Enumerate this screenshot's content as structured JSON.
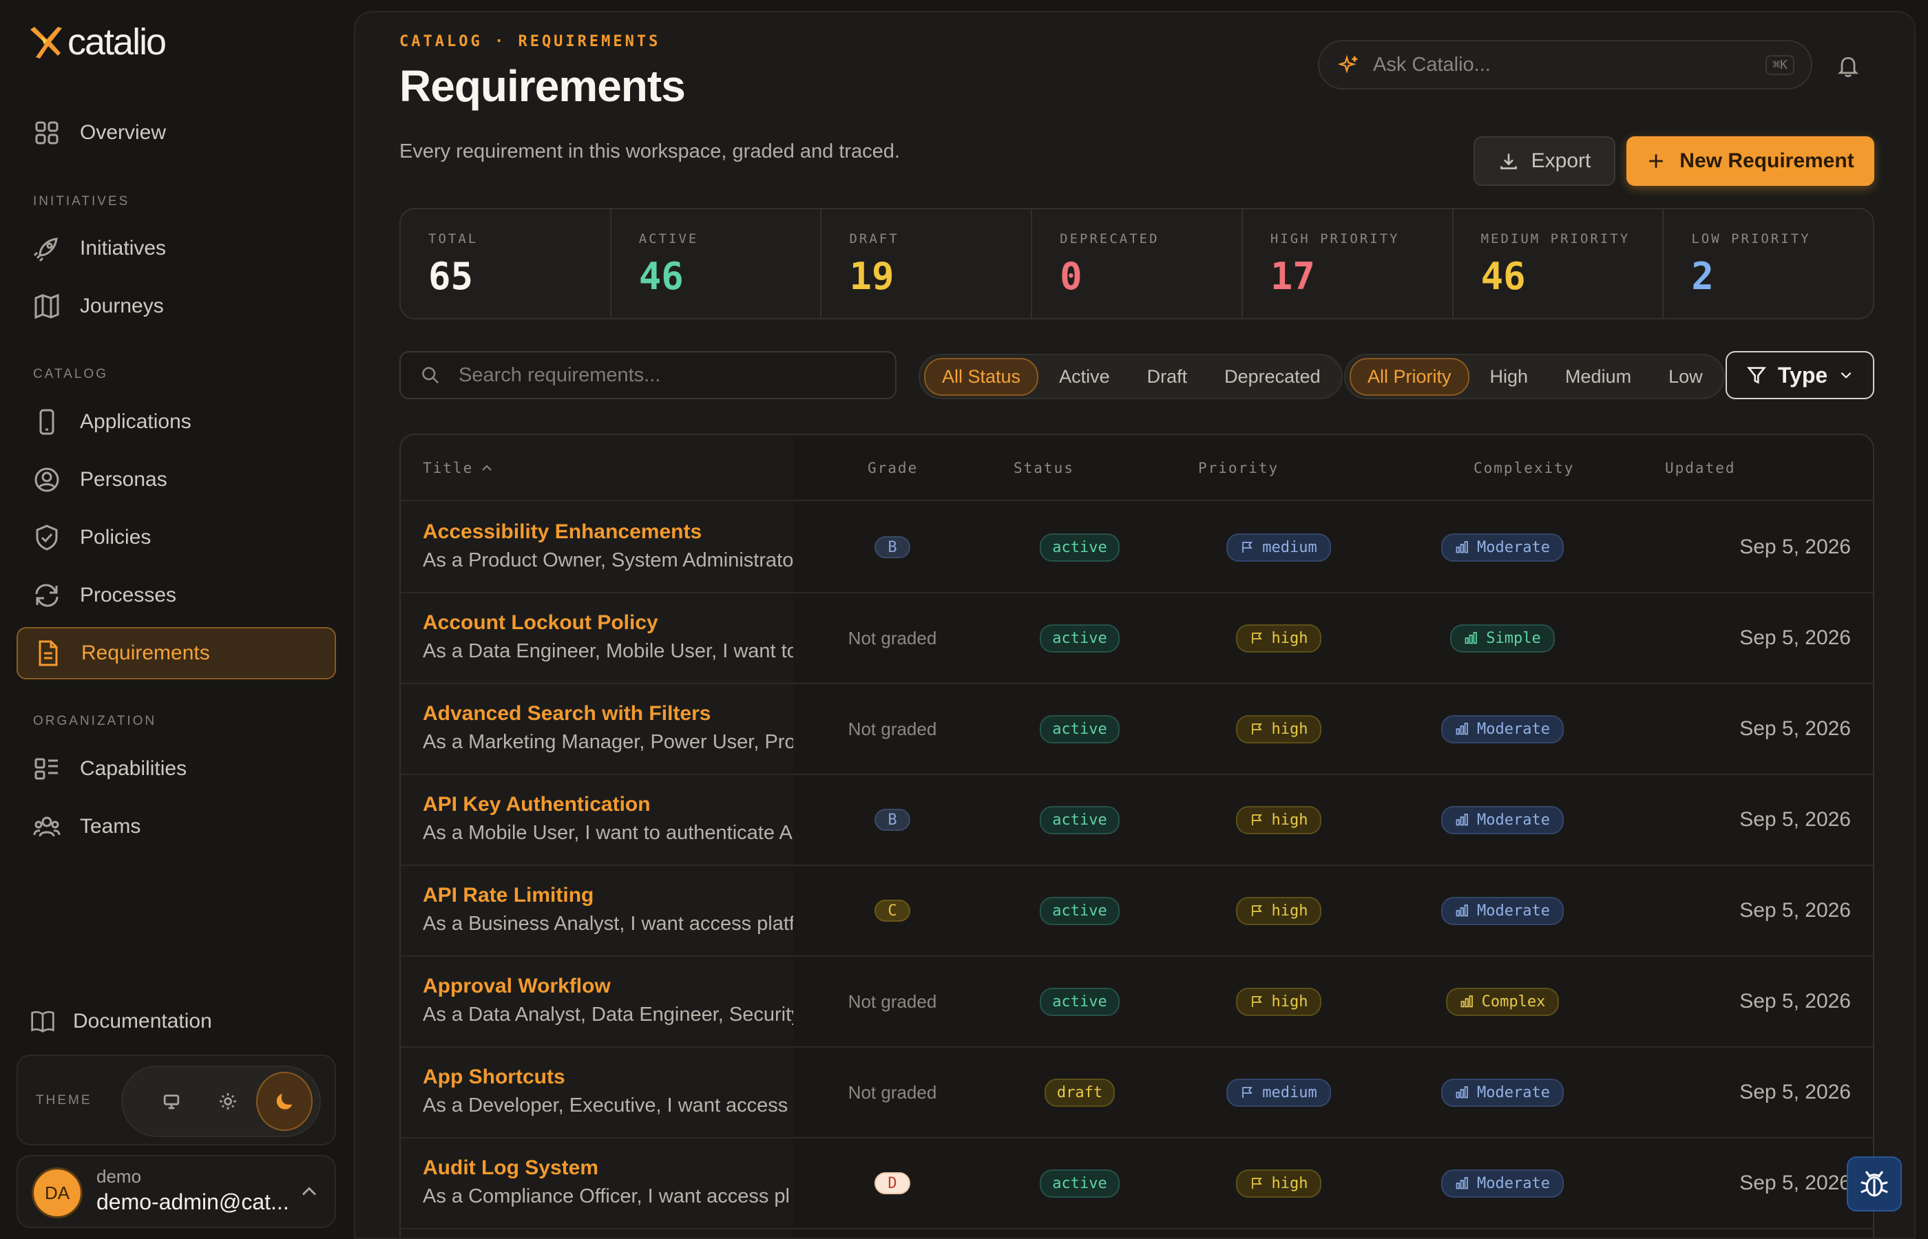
{
  "brand": {
    "name": "catalio"
  },
  "sidebar": {
    "overview": "Overview",
    "section_initiatives": "INITIATIVES",
    "initiatives": "Initiatives",
    "journeys": "Journeys",
    "section_catalog": "CATALOG",
    "applications": "Applications",
    "personas": "Personas",
    "policies": "Policies",
    "processes": "Processes",
    "requirements": "Requirements",
    "section_organization": "ORGANIZATION",
    "capabilities": "Capabilities",
    "teams": "Teams",
    "documentation": "Documentation",
    "theme_label": "THEME",
    "user": {
      "initials": "DA",
      "name": "demo",
      "email": "demo-admin@cat..."
    }
  },
  "header": {
    "breadcrumb": "CATALOG · REQUIREMENTS",
    "title": "Requirements",
    "subtitle": "Every requirement in this workspace, graded and traced.",
    "ask_placeholder": "Ask Catalio...",
    "ask_shortcut": "⌘K",
    "export_label": "Export",
    "new_label": "New Requirement"
  },
  "stats": {
    "total": {
      "label": "TOTAL",
      "value": "65"
    },
    "active": {
      "label": "ACTIVE",
      "value": "46"
    },
    "draft": {
      "label": "DRAFT",
      "value": "19"
    },
    "deprecated": {
      "label": "DEPRECATED",
      "value": "0"
    },
    "high": {
      "label": "HIGH PRIORITY",
      "value": "17"
    },
    "medium": {
      "label": "MEDIUM PRIORITY",
      "value": "46"
    },
    "low": {
      "label": "LOW PRIORITY",
      "value": "2"
    }
  },
  "filters": {
    "search_placeholder": "Search requirements...",
    "status": {
      "all": "All Status",
      "active": "Active",
      "draft": "Draft",
      "deprecated": "Deprecated"
    },
    "priority": {
      "all": "All Priority",
      "high": "High",
      "medium": "Medium",
      "low": "Low"
    },
    "type": "Type"
  },
  "table": {
    "headers": {
      "title": "Title",
      "grade": "Grade",
      "status": "Status",
      "priority": "Priority",
      "complexity": "Complexity",
      "updated": "Updated"
    },
    "rows": [
      {
        "title": "Accessibility Enhancements",
        "desc": "As a Product Owner, System Administrator",
        "grade": "B",
        "status": "active",
        "priority": "medium",
        "complexity": "Moderate",
        "updated": "Sep 5, 2026"
      },
      {
        "title": "Account Lockout Policy",
        "desc": "As a Data Engineer, Mobile User, I want to",
        "grade": "Not graded",
        "status": "active",
        "priority": "high",
        "complexity": "Simple",
        "updated": "Sep 5, 2026"
      },
      {
        "title": "Advanced Search with Filters",
        "desc": "As a Marketing Manager, Power User, Product",
        "grade": "Not graded",
        "status": "active",
        "priority": "high",
        "complexity": "Moderate",
        "updated": "Sep 5, 2026"
      },
      {
        "title": "API Key Authentication",
        "desc": "As a Mobile User, I want to authenticate API",
        "grade": "B",
        "status": "active",
        "priority": "high",
        "complexity": "Moderate",
        "updated": "Sep 5, 2026"
      },
      {
        "title": "API Rate Limiting",
        "desc": "As a Business Analyst, I want access platform",
        "grade": "C",
        "status": "active",
        "priority": "high",
        "complexity": "Moderate",
        "updated": "Sep 5, 2026"
      },
      {
        "title": "Approval Workflow",
        "desc": "As a Data Analyst, Data Engineer, Security",
        "grade": "Not graded",
        "status": "active",
        "priority": "high",
        "complexity": "Complex",
        "updated": "Sep 5, 2026"
      },
      {
        "title": "App Shortcuts",
        "desc": "As a Developer, Executive, I want access p",
        "grade": "Not graded",
        "status": "draft",
        "priority": "medium",
        "complexity": "Moderate",
        "updated": "Sep 5, 2026"
      },
      {
        "title": "Audit Log System",
        "desc": "As a Compliance Officer, I want access pl",
        "grade": "D",
        "status": "active",
        "priority": "high",
        "complexity": "Moderate",
        "updated": "Sep 5, 2026"
      }
    ]
  },
  "colors": {
    "accent": "#f39a2f",
    "active": "#5fd3a5",
    "draft": "#f2c53d",
    "deprecated": "#f0727a",
    "medium": "#f2c53d",
    "low": "#7fb0f0"
  }
}
